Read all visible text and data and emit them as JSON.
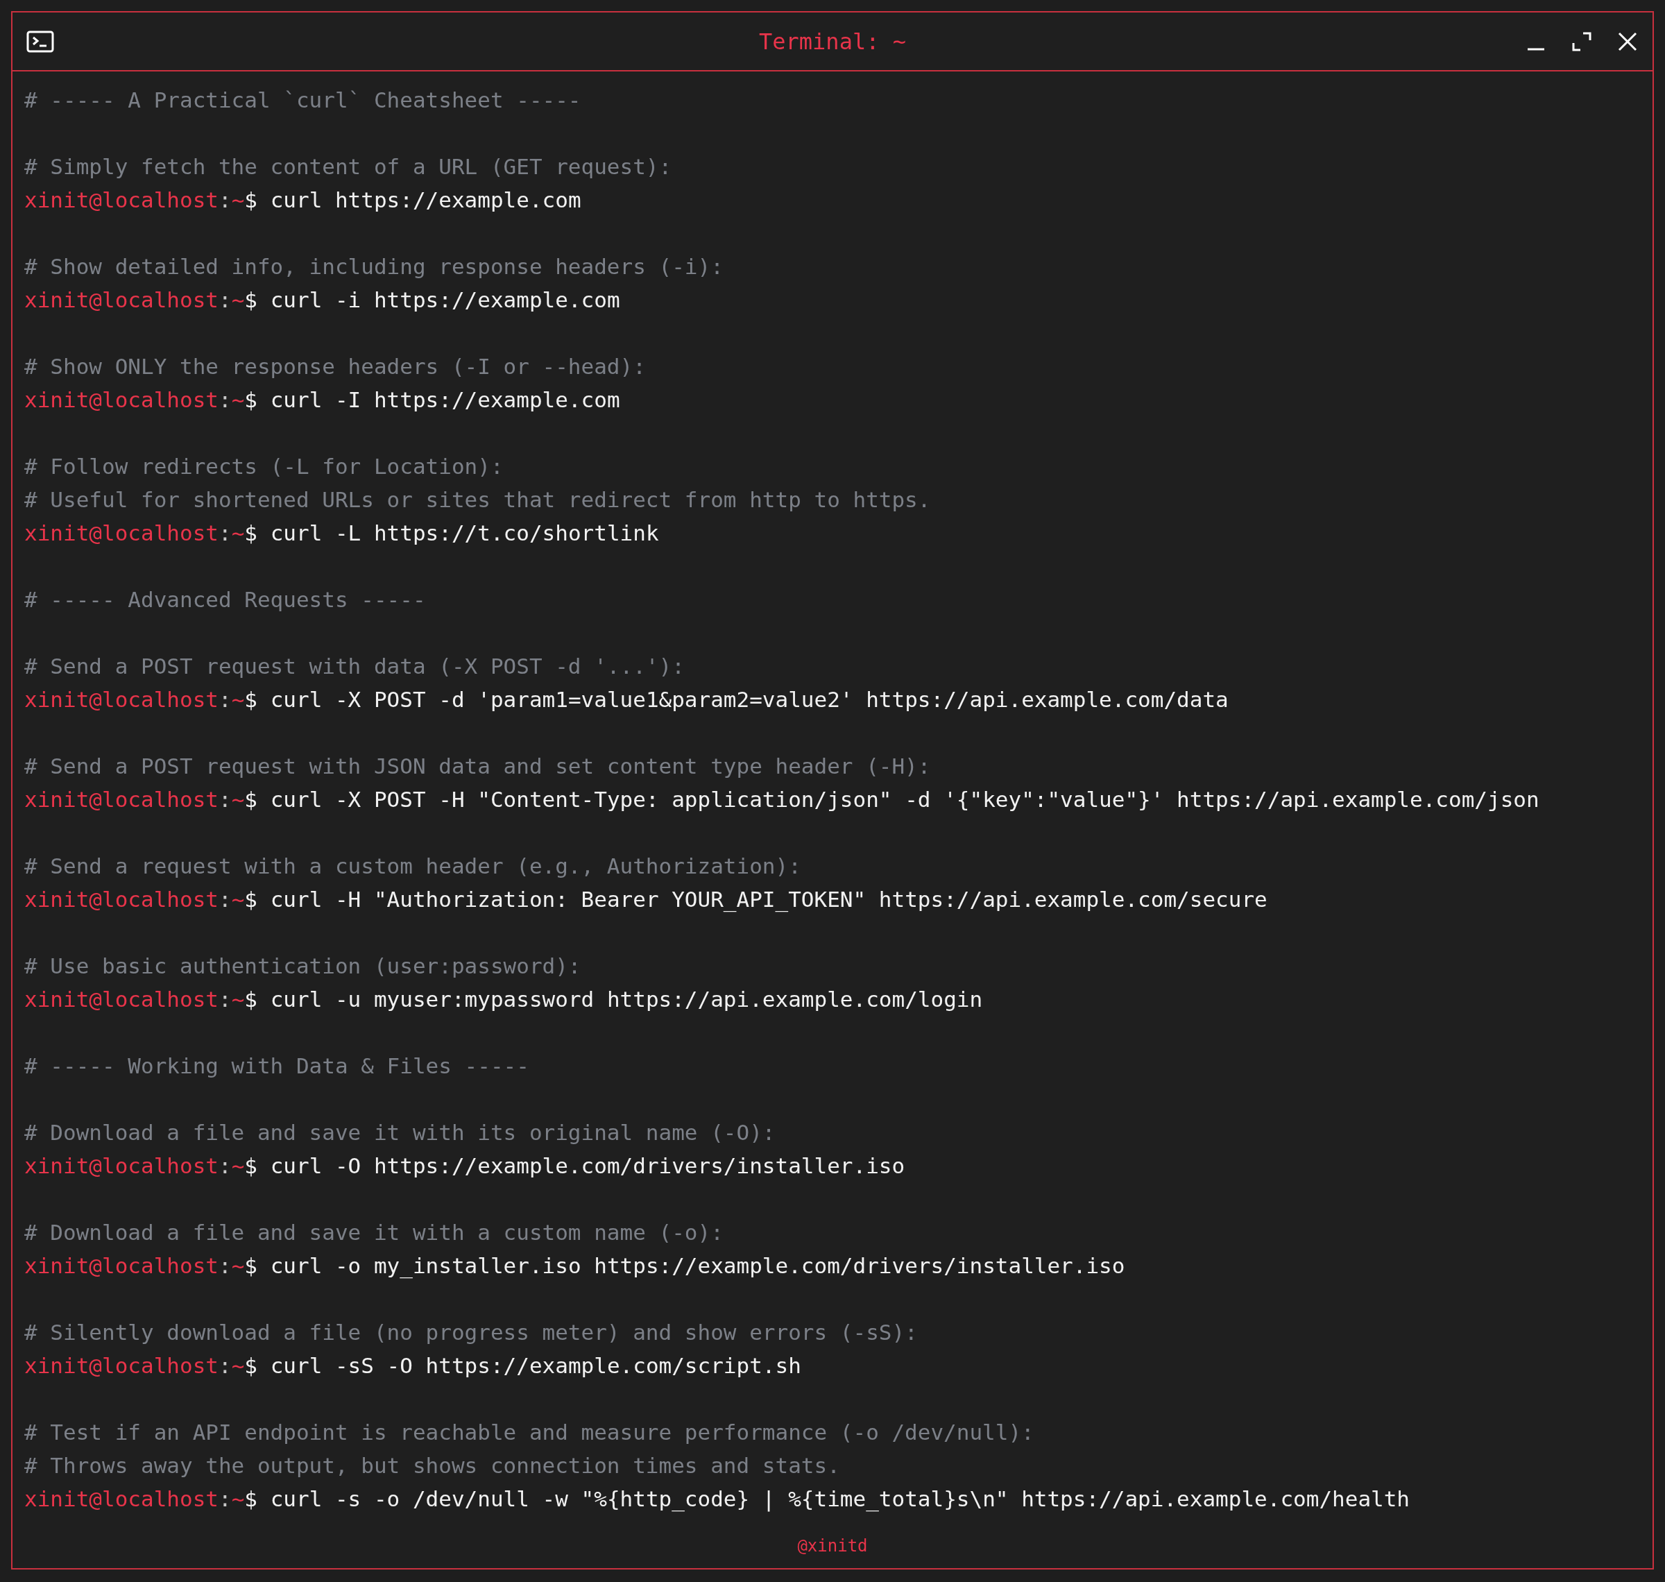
{
  "window": {
    "title": "Terminal: ~"
  },
  "lines": [
    {
      "kind": "comment",
      "text": "# ----- A Practical `curl` Cheatsheet -----"
    },
    {
      "kind": "blank"
    },
    {
      "kind": "comment",
      "text": "# Simply fetch the content of a URL (GET request):"
    },
    {
      "kind": "command",
      "user": "xinit@localhost",
      "sep": ":",
      "path": "~",
      "symbol": "$",
      "command": "curl https://example.com"
    },
    {
      "kind": "blank"
    },
    {
      "kind": "comment",
      "text": "# Show detailed info, including response headers (-i):"
    },
    {
      "kind": "command",
      "user": "xinit@localhost",
      "sep": ":",
      "path": "~",
      "symbol": "$",
      "command": "curl -i https://example.com"
    },
    {
      "kind": "blank"
    },
    {
      "kind": "comment",
      "text": "# Show ONLY the response headers (-I or --head):"
    },
    {
      "kind": "command",
      "user": "xinit@localhost",
      "sep": ":",
      "path": "~",
      "symbol": "$",
      "command": "curl -I https://example.com"
    },
    {
      "kind": "blank"
    },
    {
      "kind": "comment",
      "text": "# Follow redirects (-L for Location):"
    },
    {
      "kind": "comment",
      "text": "# Useful for shortened URLs or sites that redirect from http to https."
    },
    {
      "kind": "command",
      "user": "xinit@localhost",
      "sep": ":",
      "path": "~",
      "symbol": "$",
      "command": "curl -L https://t.co/shortlink"
    },
    {
      "kind": "blank"
    },
    {
      "kind": "comment",
      "text": "# ----- Advanced Requests -----"
    },
    {
      "kind": "blank"
    },
    {
      "kind": "comment",
      "text": "# Send a POST request with data (-X POST -d '...'):"
    },
    {
      "kind": "command",
      "user": "xinit@localhost",
      "sep": ":",
      "path": "~",
      "symbol": "$",
      "command": "curl -X POST -d 'param1=value1&param2=value2' https://api.example.com/data"
    },
    {
      "kind": "blank"
    },
    {
      "kind": "comment",
      "text": "# Send a POST request with JSON data and set content type header (-H):"
    },
    {
      "kind": "command",
      "user": "xinit@localhost",
      "sep": ":",
      "path": "~",
      "symbol": "$",
      "command": "curl -X POST -H \"Content-Type: application/json\" -d '{\"key\":\"value\"}' https://api.example.com/json"
    },
    {
      "kind": "blank"
    },
    {
      "kind": "comment",
      "text": "# Send a request with a custom header (e.g., Authorization):"
    },
    {
      "kind": "command",
      "user": "xinit@localhost",
      "sep": ":",
      "path": "~",
      "symbol": "$",
      "command": "curl -H \"Authorization: Bearer YOUR_API_TOKEN\" https://api.example.com/secure"
    },
    {
      "kind": "blank"
    },
    {
      "kind": "comment",
      "text": "# Use basic authentication (user:password):"
    },
    {
      "kind": "command",
      "user": "xinit@localhost",
      "sep": ":",
      "path": "~",
      "symbol": "$",
      "command": "curl -u myuser:mypassword https://api.example.com/login"
    },
    {
      "kind": "blank"
    },
    {
      "kind": "comment",
      "text": "# ----- Working with Data & Files -----"
    },
    {
      "kind": "blank"
    },
    {
      "kind": "comment",
      "text": "# Download a file and save it with its original name (-O):"
    },
    {
      "kind": "command",
      "user": "xinit@localhost",
      "sep": ":",
      "path": "~",
      "symbol": "$",
      "command": "curl -O https://example.com/drivers/installer.iso"
    },
    {
      "kind": "blank"
    },
    {
      "kind": "comment",
      "text": "# Download a file and save it with a custom name (-o):"
    },
    {
      "kind": "command",
      "user": "xinit@localhost",
      "sep": ":",
      "path": "~",
      "symbol": "$",
      "command": "curl -o my_installer.iso https://example.com/drivers/installer.iso"
    },
    {
      "kind": "blank"
    },
    {
      "kind": "comment",
      "text": "# Silently download a file (no progress meter) and show errors (-sS):"
    },
    {
      "kind": "command",
      "user": "xinit@localhost",
      "sep": ":",
      "path": "~",
      "symbol": "$",
      "command": "curl -sS -O https://example.com/script.sh"
    },
    {
      "kind": "blank"
    },
    {
      "kind": "comment",
      "text": "# Test if an API endpoint is reachable and measure performance (-o /dev/null):"
    },
    {
      "kind": "comment",
      "text": "# Throws away the output, but shows connection times and stats."
    },
    {
      "kind": "command",
      "user": "xinit@localhost",
      "sep": ":",
      "path": "~",
      "symbol": "$",
      "command": "curl -s -o /dev/null -w \"%{http_code} | %{time_total}s\\n\" https://api.example.com/health"
    }
  ],
  "footer": {
    "credit": "@xinitd"
  }
}
